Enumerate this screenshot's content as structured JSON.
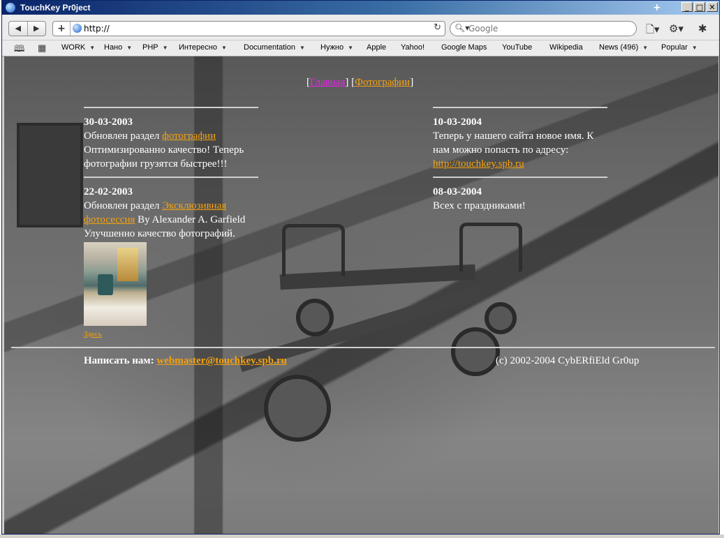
{
  "window": {
    "title": "TouchKey Pr0ject"
  },
  "toolbar": {
    "url": "http://",
    "search_placeholder": "Google"
  },
  "bookmarks": [
    {
      "label": "WORK",
      "menu": true
    },
    {
      "label": "Нано",
      "menu": true
    },
    {
      "label": "PHP",
      "menu": true
    },
    {
      "label": "Интересно",
      "menu": true
    },
    {
      "label": "Documentation",
      "menu": true
    },
    {
      "label": "Нужно",
      "menu": true
    },
    {
      "label": "Apple",
      "menu": false
    },
    {
      "label": "Yahoo!",
      "menu": false
    },
    {
      "label": "Google Maps",
      "menu": false
    },
    {
      "label": "YouTube",
      "menu": false
    },
    {
      "label": "Wikipedia",
      "menu": false
    },
    {
      "label": "News (496)",
      "menu": true
    },
    {
      "label": "Popular",
      "menu": true
    }
  ],
  "page": {
    "nav": {
      "open": "[",
      "sep": "] [",
      "close": "]",
      "home": "Главная",
      "photos": "Фотографии"
    },
    "left": [
      {
        "date": "30-03-2003",
        "pre": "Обновлен раздел ",
        "link": "фотографии",
        "post": "",
        "extra": "Оптимизированно качество! Теперь фотографии грузятся быстрее!!!"
      },
      {
        "date": "22-02-2003",
        "pre": "Обновлен раздел ",
        "link": "Эксклюзивная фотосессия",
        "post": " By Alexander A. Garfield",
        "extra": "Улучшенно качество фотографий.",
        "thumb_link": "Здесь"
      }
    ],
    "right": [
      {
        "date": "10-03-2004",
        "text": "Теперь у нашего сайта новое имя. К нам можно попасть по адресу:",
        "link": "http://touchkey.spb.ru"
      },
      {
        "date": "08-03-2004",
        "text": "Всех с праздниками!"
      }
    ],
    "footer": {
      "contact_label": "Написать нам:",
      "email": "webmaster@touchkey.spb.ru",
      "copyright": "(c) 2002-2004 CybERfiEld Gr0up"
    }
  },
  "colors": {
    "link": "#f5a20e",
    "visited_link": "#ee22ee",
    "titlebar": "#0a246a"
  }
}
